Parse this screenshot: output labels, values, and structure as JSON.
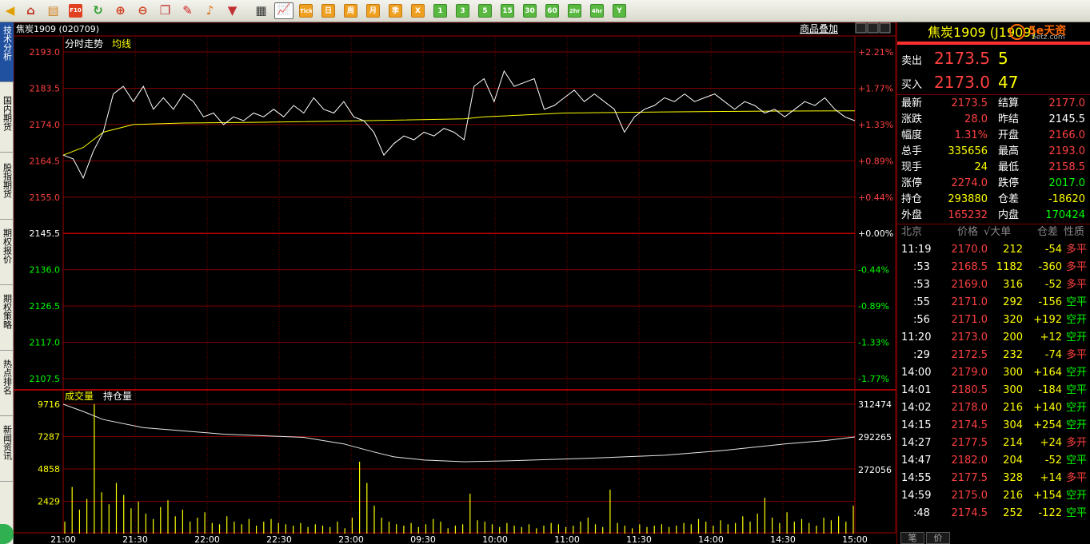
{
  "toolbar": {
    "icons": [
      "back-icon",
      "home-icon",
      "notebook-icon",
      "f10-icon",
      "refresh-icon",
      "zoom-in-icon",
      "zoom-out-icon",
      "window-icon",
      "pen-icon",
      "bell-icon",
      "filter-icon",
      "table-icon",
      "chart-icon"
    ],
    "tick_label": "Tick",
    "period_cn": [
      "日",
      "周",
      "月",
      "季",
      "X"
    ],
    "period_min": [
      "1",
      "3",
      "5",
      "15",
      "30",
      "60",
      "2hr",
      "4hr",
      "Y"
    ],
    "selected": "chart-icon"
  },
  "sidebar": {
    "tabs": [
      "技术分析",
      "国内期货",
      "股指期货",
      "期权报价",
      "期权策略",
      "热点排名",
      "新闻资讯"
    ],
    "active_index": 0
  },
  "chart": {
    "title": "焦炭1909 (020709)",
    "legend_price": "分时走势",
    "legend_avg": "均线",
    "overlay_link": "商品叠加",
    "vol_legend_1": "成交量",
    "vol_legend_2": "持仓量",
    "price_axis": {
      "labels": [
        "2193.0",
        "2183.5",
        "2174.0",
        "2164.5",
        "2155.0",
        "2145.5",
        "2136.0",
        "2126.5",
        "2117.0",
        "2107.5"
      ],
      "pct_labels": [
        "+2.21%",
        "+1.77%",
        "+1.33%",
        "+0.89%",
        "+0.44%",
        "+0.00%",
        "-0.44%",
        "-0.89%",
        "-1.33%",
        "-1.77%"
      ],
      "prev_settle": 2145.5
    },
    "volume_axis": {
      "labels": [
        "9716",
        "7287",
        "4858",
        "2429"
      ]
    },
    "oi_axis": {
      "labels": [
        "312474",
        "292265",
        "272056"
      ]
    },
    "time_labels": [
      "21:00",
      "21:30",
      "22:00",
      "22:30",
      "23:00",
      "09:30",
      "10:00",
      "11:00",
      "11:30",
      "14:00",
      "14:30",
      "15:00"
    ]
  },
  "chart_data": {
    "type": "line",
    "x_labels": [
      "21:00",
      "21:30",
      "22:00",
      "22:30",
      "23:00",
      "09:30",
      "10:00",
      "11:00",
      "11:30",
      "14:00",
      "14:30",
      "15:00"
    ],
    "series": [
      {
        "name": "分时走势",
        "points": [
          [
            0,
            2166
          ],
          [
            5,
            2165
          ],
          [
            10,
            2160
          ],
          [
            15,
            2167
          ],
          [
            20,
            2172
          ],
          [
            25,
            2182
          ],
          [
            30,
            2184
          ],
          [
            35,
            2180
          ],
          [
            40,
            2184
          ],
          [
            45,
            2178
          ],
          [
            50,
            2181
          ],
          [
            55,
            2178
          ],
          [
            60,
            2182
          ],
          [
            65,
            2180
          ],
          [
            70,
            2176
          ],
          [
            75,
            2177
          ],
          [
            80,
            2174
          ],
          [
            85,
            2176
          ],
          [
            90,
            2175
          ],
          [
            95,
            2177
          ],
          [
            100,
            2176
          ],
          [
            105,
            2178
          ],
          [
            110,
            2176
          ],
          [
            115,
            2179
          ],
          [
            120,
            2177
          ],
          [
            125,
            2181
          ],
          [
            130,
            2178
          ],
          [
            135,
            2177
          ],
          [
            140,
            2180
          ],
          [
            145,
            2176
          ],
          [
            150,
            2175
          ],
          [
            155,
            2172
          ],
          [
            160,
            2166
          ],
          [
            165,
            2169
          ],
          [
            170,
            2171
          ],
          [
            175,
            2170
          ],
          [
            180,
            2172
          ],
          [
            185,
            2171
          ],
          [
            190,
            2173
          ],
          [
            195,
            2172
          ],
          [
            200,
            2170
          ],
          [
            205,
            2184
          ],
          [
            210,
            2186
          ],
          [
            215,
            2180
          ],
          [
            220,
            2188
          ],
          [
            225,
            2184
          ],
          [
            230,
            2185
          ],
          [
            235,
            2186
          ],
          [
            240,
            2178
          ],
          [
            245,
            2179
          ],
          [
            250,
            2181
          ],
          [
            255,
            2183
          ],
          [
            260,
            2180
          ],
          [
            265,
            2182
          ],
          [
            270,
            2180
          ],
          [
            275,
            2178
          ],
          [
            280,
            2172
          ],
          [
            285,
            2176
          ],
          [
            290,
            2178
          ],
          [
            295,
            2179
          ],
          [
            300,
            2181
          ],
          [
            305,
            2180
          ],
          [
            310,
            2182
          ],
          [
            315,
            2180
          ],
          [
            320,
            2181
          ],
          [
            325,
            2182
          ],
          [
            330,
            2180
          ],
          [
            335,
            2178
          ],
          [
            340,
            2180
          ],
          [
            345,
            2179
          ],
          [
            350,
            2177
          ],
          [
            355,
            2178
          ],
          [
            360,
            2176
          ],
          [
            365,
            2178
          ],
          [
            370,
            2180
          ],
          [
            375,
            2179
          ],
          [
            380,
            2181
          ],
          [
            385,
            2178
          ],
          [
            390,
            2176
          ],
          [
            395,
            2175
          ]
        ]
      },
      {
        "name": "均线",
        "points": [
          [
            0,
            2166
          ],
          [
            10,
            2168
          ],
          [
            20,
            2172
          ],
          [
            35,
            2174
          ],
          [
            60,
            2174.4
          ],
          [
            100,
            2174.6
          ],
          [
            150,
            2175
          ],
          [
            200,
            2175.5
          ],
          [
            210,
            2176
          ],
          [
            250,
            2177
          ],
          [
            300,
            2177.3
          ],
          [
            350,
            2177.5
          ],
          [
            395,
            2177.6
          ]
        ]
      }
    ],
    "volume_bars": [
      900,
      3500,
      1800,
      2600,
      9716,
      3100,
      2200,
      3800,
      2900,
      1900,
      2400,
      1500,
      1100,
      2000,
      2500,
      1300,
      1800,
      900,
      1200,
      1600,
      800,
      700,
      1300,
      900,
      700,
      1100,
      600,
      900,
      1100,
      800,
      700,
      600,
      800,
      500,
      700,
      600,
      500,
      900,
      400,
      1200,
      5400,
      3800,
      2100,
      1200,
      900,
      700,
      600,
      800,
      500,
      700,
      1100,
      900,
      400,
      600,
      700,
      3000,
      1000,
      900,
      700,
      500,
      800,
      600,
      500,
      700,
      400,
      600,
      800,
      700,
      500,
      600,
      900,
      1200,
      700,
      500,
      3300,
      800,
      600,
      400,
      700,
      500,
      600,
      700,
      500,
      600,
      800,
      700,
      1100,
      900,
      600,
      1000,
      700,
      800,
      1300,
      900,
      1500,
      2700,
      1200,
      800,
      1600,
      900,
      1100,
      800,
      600,
      1200,
      1000,
      1300,
      900,
      2100
    ],
    "oi_points": [
      [
        0,
        312474
      ],
      [
        10,
        308000
      ],
      [
        20,
        303000
      ],
      [
        40,
        298000
      ],
      [
        60,
        296000
      ],
      [
        80,
        294000
      ],
      [
        120,
        292000
      ],
      [
        140,
        288000
      ],
      [
        155,
        283000
      ],
      [
        165,
        280000
      ],
      [
        180,
        278000
      ],
      [
        200,
        277000
      ],
      [
        220,
        277500
      ],
      [
        260,
        279000
      ],
      [
        300,
        281000
      ],
      [
        330,
        284000
      ],
      [
        360,
        288000
      ],
      [
        380,
        290000
      ],
      [
        395,
        292265
      ]
    ],
    "ylim": [
      2107.5,
      2193.0
    ],
    "vol_max": 9716,
    "oi_range": [
      272056,
      312474
    ]
  },
  "panel": {
    "product": "焦炭1909 (J1909)",
    "brand": "5e天资",
    "brand_sub": "5etz.com",
    "ask": {
      "label": "卖出",
      "price": "2173.5",
      "vol": "5"
    },
    "bid": {
      "label": "买入",
      "price": "2173.0",
      "vol": "47"
    },
    "stats": [
      {
        "k1": "最新",
        "v1": "2173.5",
        "c1": "#ff4040",
        "k2": "结算",
        "v2": "2177.0",
        "c2": "#ff4040"
      },
      {
        "k1": "涨跌",
        "v1": "28.0",
        "c1": "#ff4040",
        "k2": "昨结",
        "v2": "2145.5",
        "c2": "#ffffff"
      },
      {
        "k1": "幅度",
        "v1": "1.31%",
        "c1": "#ff4040",
        "k2": "开盘",
        "v2": "2166.0",
        "c2": "#ff4040"
      },
      {
        "k1": "总手",
        "v1": "335656",
        "c1": "#ffff00",
        "k2": "最高",
        "v2": "2193.0",
        "c2": "#ff4040"
      },
      {
        "k1": "现手",
        "v1": "24",
        "c1": "#ffff00",
        "k2": "最低",
        "v2": "2158.5",
        "c2": "#ff4040"
      },
      {
        "k1": "涨停",
        "v1": "2274.0",
        "c1": "#ff4040",
        "k2": "跌停",
        "v2": "2017.0",
        "c2": "#00ff00"
      },
      {
        "k1": "持仓",
        "v1": "293880",
        "c1": "#ffff00",
        "k2": "仓差",
        "v2": "-18620",
        "c2": "#ffff00"
      },
      {
        "k1": "外盘",
        "v1": "165232",
        "c1": "#ff4040",
        "k2": "内盘",
        "v2": "170424",
        "c2": "#00ff00"
      }
    ],
    "tick_headers": {
      "time": "北京",
      "price": "价格",
      "vol": "√大单",
      "oi": "仓差",
      "nature": "性质"
    },
    "ticks": [
      {
        "t": "11:19",
        "p": "2170.0",
        "v": "212",
        "oi": "-54",
        "n": "多平",
        "nc": "#ff4040"
      },
      {
        "t": ":53",
        "p": "2168.5",
        "v": "1182",
        "oi": "-360",
        "n": "多平",
        "nc": "#ff4040"
      },
      {
        "t": ":53",
        "p": "2169.0",
        "v": "316",
        "oi": "-52",
        "n": "多平",
        "nc": "#ff4040"
      },
      {
        "t": ":55",
        "p": "2171.0",
        "v": "292",
        "oi": "-156",
        "n": "空平",
        "nc": "#00ff00"
      },
      {
        "t": ":56",
        "p": "2171.0",
        "v": "320",
        "oi": "+192",
        "n": "空开",
        "nc": "#00ff00"
      },
      {
        "t": "11:20",
        "p": "2173.0",
        "v": "200",
        "oi": "+12",
        "n": "空开",
        "nc": "#00ff00"
      },
      {
        "t": ":29",
        "p": "2172.5",
        "v": "232",
        "oi": "-74",
        "n": "多平",
        "nc": "#ff4040"
      },
      {
        "t": "14:00",
        "p": "2179.0",
        "v": "300",
        "oi": "+164",
        "n": "空开",
        "nc": "#00ff00"
      },
      {
        "t": "14:01",
        "p": "2180.5",
        "v": "300",
        "oi": "-184",
        "n": "空平",
        "nc": "#00ff00"
      },
      {
        "t": "14:02",
        "p": "2178.0",
        "v": "216",
        "oi": "+140",
        "n": "空开",
        "nc": "#00ff00"
      },
      {
        "t": "14:15",
        "p": "2174.5",
        "v": "304",
        "oi": "+254",
        "n": "空开",
        "nc": "#00ff00"
      },
      {
        "t": "14:27",
        "p": "2177.5",
        "v": "214",
        "oi": "+24",
        "n": "多开",
        "nc": "#ff4040"
      },
      {
        "t": "14:47",
        "p": "2182.0",
        "v": "204",
        "oi": "-52",
        "n": "空平",
        "nc": "#00ff00"
      },
      {
        "t": "14:55",
        "p": "2177.5",
        "v": "328",
        "oi": "+14",
        "n": "多平",
        "nc": "#ff4040"
      },
      {
        "t": "14:59",
        "p": "2175.0",
        "v": "216",
        "oi": "+154",
        "n": "空开",
        "nc": "#00ff00"
      },
      {
        "t": ":48",
        "p": "2174.5",
        "v": "252",
        "oi": "-122",
        "n": "空平",
        "nc": "#00ff00"
      }
    ],
    "bottom_tabs": [
      "笔",
      "价"
    ]
  }
}
